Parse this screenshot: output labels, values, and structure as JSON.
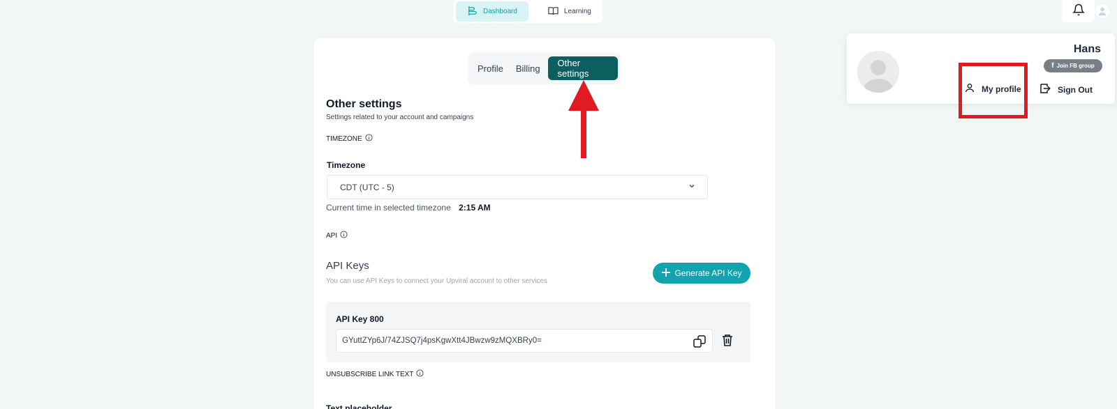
{
  "nav": {
    "dashboard": "Dashboard",
    "learning": "Learning"
  },
  "profile_popup": {
    "name": "Hans",
    "fb_badge": "Join FB group",
    "my_profile": "My profile",
    "sign_out": "Sign Out"
  },
  "tabs": [
    "Profile",
    "Billing",
    "Other settings"
  ],
  "active_tab": "Other settings",
  "settings": {
    "title": "Other settings",
    "subtitle": "Settings related to your account and campaigns",
    "timezone_section": "TIMEZONE",
    "timezone_label": "Timezone",
    "timezone_value": "CDT (UTC - 5)",
    "current_time_label": "Current time in selected timezone",
    "current_time_value": "2:15 AM",
    "api_section": "API",
    "api_title": "API Keys",
    "api_subtitle": "You can use API Keys to connect your Upviral account to other services",
    "generate_button": "Generate API Key",
    "api_key_label": "API Key 800",
    "api_key_value": "GYuttZYp6J/74ZJSQ7j4psKgwXtt4JBwzw9zMQXBRy0=",
    "unsubscribe_section": "UNSUBSCRIBE LINK TEXT",
    "text_placeholder_label": "Text placeholder"
  },
  "colors": {
    "accent": "#12a3ae",
    "tab_active": "#0d5f5f",
    "annotation_red": "#e01b22",
    "background": "#f3f6f6"
  }
}
